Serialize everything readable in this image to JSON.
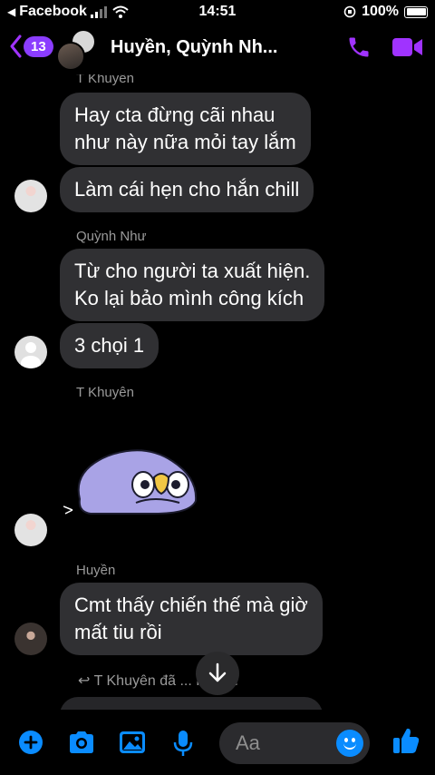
{
  "status_bar": {
    "back_app": "Facebook",
    "time": "14:51",
    "battery": "100%"
  },
  "header": {
    "unread_count": "13",
    "title": "Huyền, Quỳnh Nh..."
  },
  "messages": [
    {
      "sender": "T Khuyên"
    },
    {
      "text": "Hay cta đừng cãi nhau\nnhư này nữa mỏi tay lắm"
    },
    {
      "text": "Làm cái hẹn cho hắn chill"
    },
    {
      "sender": "Quỳnh Như"
    },
    {
      "text": "Từ cho người ta xuất hiện.\nKo lại bảo mình công kích"
    },
    {
      "text": "3 chọi 1"
    },
    {
      "sender": "T Khuyên"
    },
    {
      "sender": "Huyền"
    },
    {
      "text": "Cmt thấy chiến thế mà giờ\nmất tiu rồi"
    },
    {
      "reply": "T Khuyên đã ... Huyền"
    }
  ],
  "composer": {
    "placeholder": "Aa"
  },
  "icons": {
    "accent": "#0a8cff",
    "header_accent": "#a033ff",
    "names": [
      "back-chevron-icon",
      "phone-icon",
      "video-camera-icon",
      "plus-icon",
      "camera-icon",
      "image-icon",
      "microphone-icon",
      "emoji-icon",
      "thumbs-up-icon",
      "arrow-down-icon"
    ]
  }
}
